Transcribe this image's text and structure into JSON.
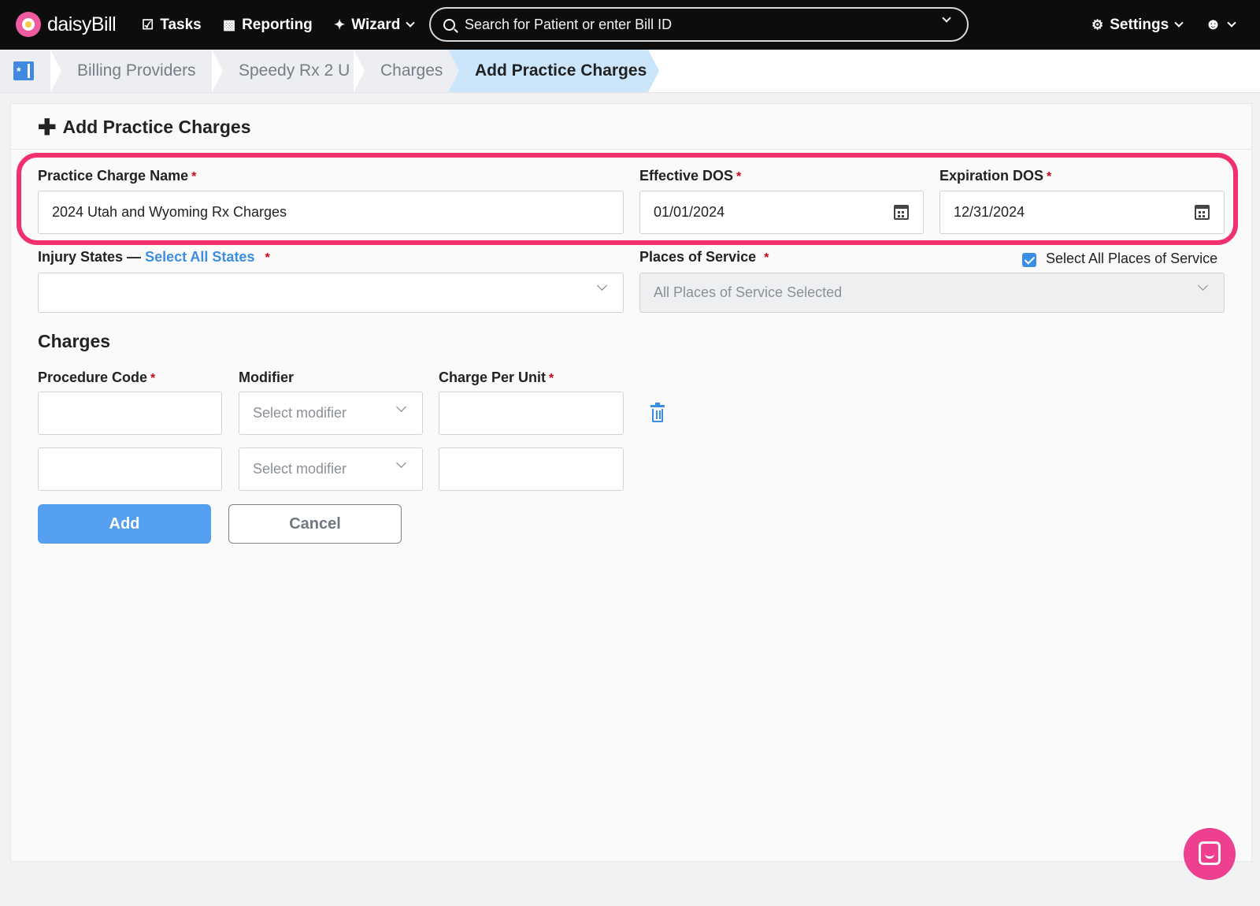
{
  "app": {
    "name": "daisyBill"
  },
  "nav": {
    "tasks": "Tasks",
    "reporting": "Reporting",
    "wizard": "Wizard",
    "search_placeholder": "Search for Patient or enter Bill ID",
    "settings": "Settings"
  },
  "breadcrumb": [
    "Billing Providers",
    "Speedy Rx 2 U",
    "Charges",
    "Add Practice Charges"
  ],
  "form": {
    "title": "Add Practice Charges",
    "charge_name_label": "Practice Charge Name",
    "charge_name_value": "2024 Utah and Wyoming Rx Charges",
    "effective_label": "Effective DOS",
    "effective_value": "01/01/2024",
    "expiration_label": "Expiration DOS",
    "expiration_value": "12/31/2024",
    "injury_states_label": "Injury States —",
    "select_all_states": "Select All States",
    "injury_states_value": "",
    "places_label": "Places of Service",
    "select_all_places": "Select All Places of Service",
    "select_all_places_checked": true,
    "places_value": "All Places of Service Selected",
    "required_mark": "*"
  },
  "charges": {
    "title": "Charges",
    "procedure_code_label": "Procedure Code",
    "modifier_label": "Modifier",
    "charge_per_unit_label": "Charge Per Unit",
    "modifier_placeholder": "Select modifier",
    "rows": [
      {
        "procedure_code": "",
        "modifier": "",
        "charge_per_unit": ""
      },
      {
        "procedure_code": "",
        "modifier": "",
        "charge_per_unit": ""
      }
    ]
  },
  "buttons": {
    "add": "Add",
    "cancel": "Cancel"
  },
  "colors": {
    "accent": "#3c8ee3",
    "highlight": "#f2306d",
    "brand_pink": "#ef5ba1",
    "topbar": "#0d0d0d"
  },
  "icons": [
    "daisy-logo-icon",
    "tasks-icon",
    "reporting-icon",
    "wizard-icon",
    "search-icon",
    "gear-icon",
    "user-icon",
    "provider-icon",
    "plus-icon",
    "calendar-icon",
    "trash-icon",
    "chat-icon"
  ]
}
